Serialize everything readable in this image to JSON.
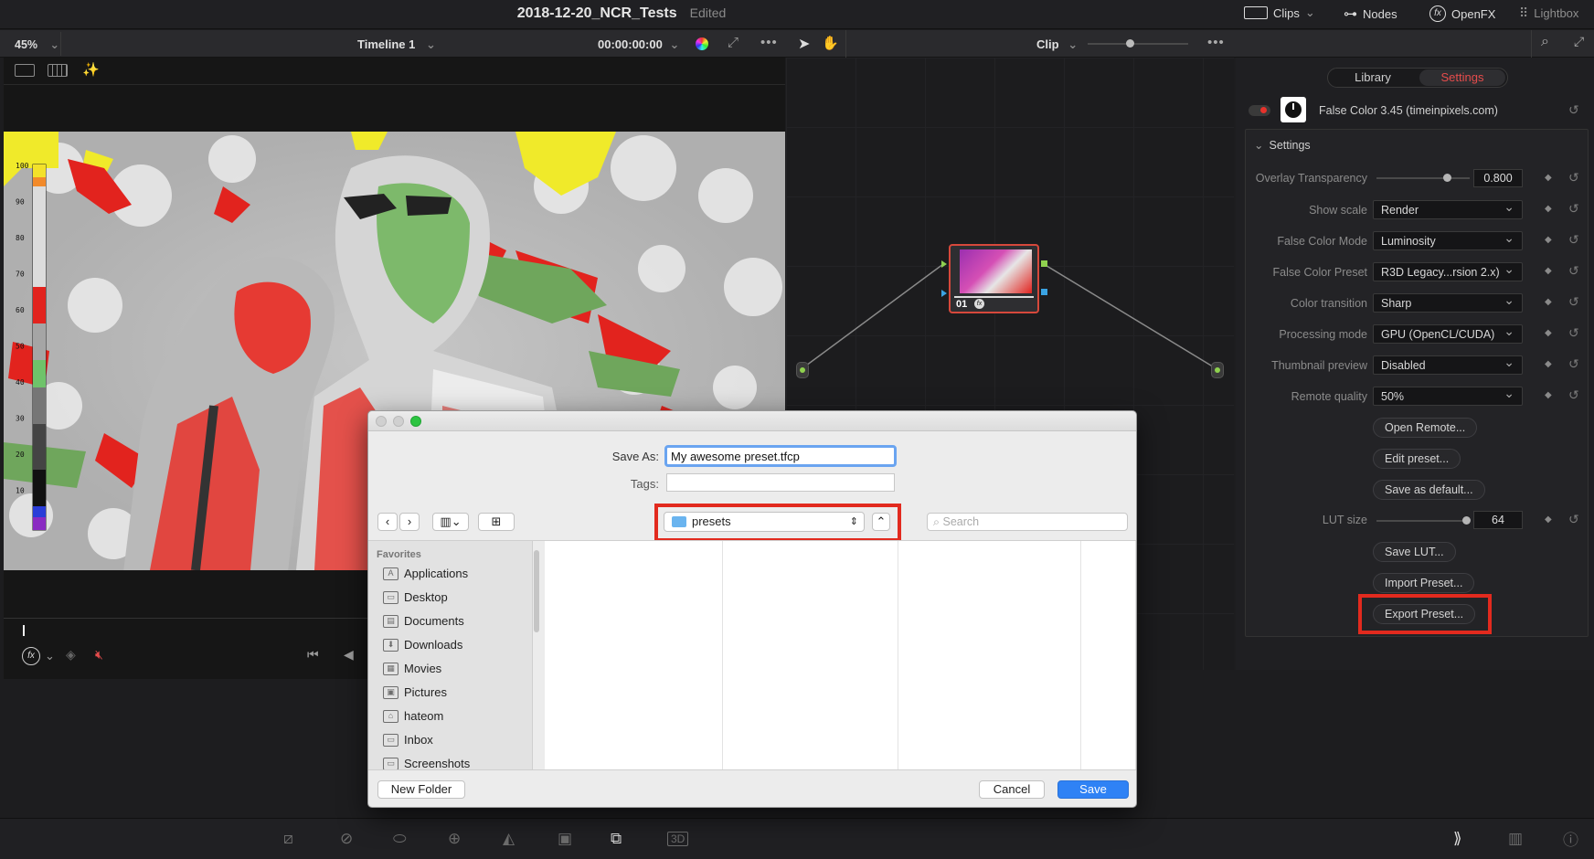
{
  "project": {
    "title": "2018-12-20_NCR_Tests",
    "status": "Edited"
  },
  "top_tools": {
    "clips": "Clips",
    "nodes": "Nodes",
    "openfx": "OpenFX",
    "lightbox": "Lightbox"
  },
  "viewer": {
    "zoom": "45%",
    "timeline": "Timeline 1",
    "timecode": "00:00:00:00"
  },
  "node_editor": {
    "mode": "Clip",
    "node_number": "01"
  },
  "scale_labels": [
    "100",
    "90",
    "80",
    "70",
    "60",
    "50",
    "40",
    "30",
    "20",
    "10"
  ],
  "inspector": {
    "tabs": {
      "library": "Library",
      "settings": "Settings"
    },
    "plugin_name": "False Color 3.45 (timeinpixels.com)",
    "section": "Settings",
    "overlay_transparency": {
      "label": "Overlay Transparency",
      "value": "0.800",
      "level": 0.8
    },
    "rows": [
      {
        "label": "Show scale",
        "value": "Render"
      },
      {
        "label": "False Color Mode",
        "value": "Luminosity"
      },
      {
        "label": "False Color Preset",
        "value": "R3D Legacy...rsion 2.x)"
      },
      {
        "label": "Color transition",
        "value": "Sharp"
      },
      {
        "label": "Processing mode",
        "value": "GPU (OpenCL/CUDA)"
      },
      {
        "label": "Thumbnail preview",
        "value": "Disabled"
      },
      {
        "label": "Remote quality",
        "value": "50%"
      }
    ],
    "buttons": {
      "open_remote": "Open Remote...",
      "edit_preset": "Edit preset...",
      "save_default": "Save as default...",
      "save_lut": "Save LUT...",
      "import_preset": "Import Preset...",
      "export_preset": "Export Preset..."
    },
    "lut_size": {
      "label": "LUT size",
      "value": "64"
    }
  },
  "dialog": {
    "save_as_label": "Save As:",
    "filename": "My awesome preset.tfcp",
    "tags_label": "Tags:",
    "location": "presets",
    "search_placeholder": "Search",
    "favorites_label": "Favorites",
    "favorites": [
      "Applications",
      "Desktop",
      "Documents",
      "Downloads",
      "Movies",
      "Pictures",
      "hateom",
      "Inbox",
      "Screenshots"
    ],
    "new_folder": "New Folder",
    "cancel": "Cancel",
    "save": "Save"
  },
  "colors": {
    "accent": "#e64c4c",
    "highlight_box": "#e22a1e",
    "save_button": "#2f82f5",
    "node_border": "#d6483b"
  }
}
